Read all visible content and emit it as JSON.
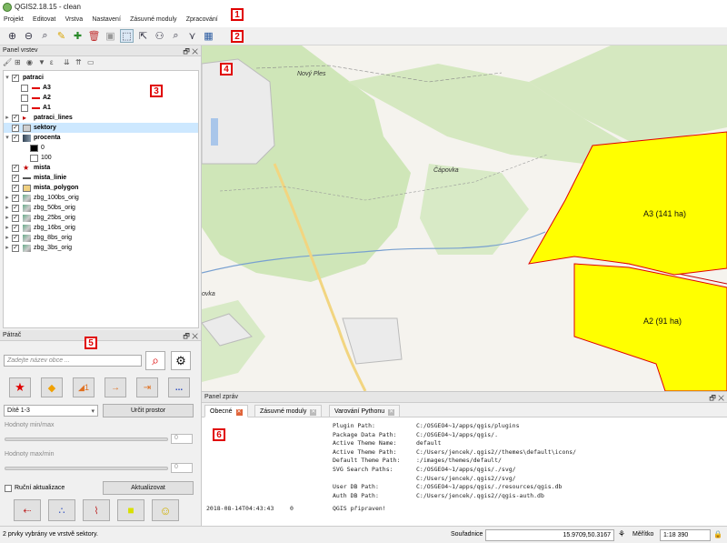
{
  "window": {
    "title": "QGIS2.18.15 - clean"
  },
  "menu": [
    "Projekt",
    "Editovat",
    "Vrstva",
    "Nastavení",
    "Zásuvné moduly",
    "Zpracování"
  ],
  "toolbar": {
    "icons": [
      "zoom-in-icon",
      "zoom-out-icon",
      "zoom-full-icon",
      "pencil-icon",
      "add-vector-icon",
      "delete-icon",
      "save-icon",
      "select-icon",
      "deselect-icon",
      "merge-icon",
      "search-icon",
      "node-tool-icon",
      "grid-icon"
    ]
  },
  "annotations": [
    "1",
    "2",
    "3",
    "4",
    "5",
    "6"
  ],
  "layers_panel": {
    "title": "Panel vrstev",
    "items": [
      {
        "label": "patraci",
        "bold": true,
        "checked": true,
        "expand": "▾",
        "indent": 0
      },
      {
        "label": "A3",
        "bold": true,
        "checked": false,
        "indent": 1,
        "color": "#e00000",
        "sym": "line"
      },
      {
        "label": "A2",
        "bold": true,
        "checked": false,
        "indent": 1,
        "color": "#e00000",
        "sym": "line"
      },
      {
        "label": "A1",
        "bold": true,
        "checked": false,
        "indent": 1,
        "color": "#e00000",
        "sym": "line"
      },
      {
        "label": "patraci_lines",
        "bold": true,
        "checked": true,
        "expand": "▸",
        "indent": 0,
        "color": "#c00000",
        "sym": "tri"
      },
      {
        "label": "sektory",
        "bold": true,
        "checked": true,
        "indent": 0,
        "selected": true,
        "color": "#cfcfcf",
        "sym": "fill"
      },
      {
        "label": "procenta",
        "bold": true,
        "checked": true,
        "expand": "▾",
        "indent": 0,
        "color": "#567",
        "sym": "raster"
      },
      {
        "label": "0",
        "bold": false,
        "indent": 2,
        "color": "#000",
        "sym": "fill"
      },
      {
        "label": "100",
        "bold": false,
        "indent": 2,
        "color": "#fff",
        "sym": "fill"
      },
      {
        "label": "mista",
        "bold": true,
        "checked": true,
        "indent": 0,
        "color": "#c00000",
        "sym": "star"
      },
      {
        "label": "mista_linie",
        "bold": true,
        "checked": true,
        "indent": 0,
        "color": "#555",
        "sym": "line"
      },
      {
        "label": "mista_polygon",
        "bold": true,
        "checked": true,
        "indent": 0,
        "color": "#f0d080",
        "sym": "fill"
      },
      {
        "label": "zbg_100bs_orig",
        "bold": false,
        "checked": true,
        "expand": "▸",
        "indent": 0,
        "sym": "raster2"
      },
      {
        "label": "zbg_50bs_orig",
        "bold": false,
        "checked": true,
        "expand": "▸",
        "indent": 0,
        "sym": "raster2"
      },
      {
        "label": "zbg_25bs_orig",
        "bold": false,
        "checked": true,
        "expand": "▸",
        "indent": 0,
        "sym": "raster2"
      },
      {
        "label": "zbg_16bs_orig",
        "bold": false,
        "checked": true,
        "expand": "▸",
        "indent": 0,
        "sym": "raster2"
      },
      {
        "label": "zbg_8bs_orig",
        "bold": false,
        "checked": true,
        "expand": "▸",
        "indent": 0,
        "sym": "raster2"
      },
      {
        "label": "zbg_3bs_orig",
        "bold": false,
        "checked": true,
        "expand": "▸",
        "indent": 0,
        "sym": "raster2"
      }
    ]
  },
  "patrac_panel": {
    "title": "Pátrač",
    "search_placeholder": "Zadejte název obce ...",
    "select_value": "Dítě 1-3",
    "determine_button": "Určit prostor",
    "min_max_label": "Hodnoty min/max",
    "max_max_label": "Hodnoty max/min",
    "spin_value": "0",
    "manual_update_label": "Ruční aktualizace",
    "update_button": "Aktualizovat",
    "more_label": "..."
  },
  "map": {
    "labels": {
      "town": "Nový Ples",
      "village": "Čápovka",
      "edge_town": "ovka"
    },
    "polygons": [
      {
        "label": "A3 (141 ha)",
        "color": "#ffff00"
      },
      {
        "label": "A2 (91 ha)",
        "color": "#ffff00"
      }
    ]
  },
  "messages_panel": {
    "title": "Panel zpráv",
    "tabs": [
      {
        "label": "Obecné",
        "active": true
      },
      {
        "label": "Zásuvné moduly",
        "active": false
      },
      {
        "label": "Varování Pythonu",
        "active": false
      }
    ],
    "log": [
      {
        "key": "Plugin Path:",
        "value": "C:/OSGEO4~1/apps/qgis/plugins"
      },
      {
        "key": "Package Data Path:",
        "value": "C:/OSGEO4~1/apps/qgis/."
      },
      {
        "key": "Active Theme Name:",
        "value": "default"
      },
      {
        "key": "Active Theme Path:",
        "value": "C:/Users/jencek/.qgis2//themes\\default\\icons/"
      },
      {
        "key": "Default Theme Path:",
        "value": ":/images/themes/default/"
      },
      {
        "key": "SVG Search Paths:",
        "value": "C:/OSGEO4~1/apps/qgis/./svg/"
      },
      {
        "key": "",
        "value": "C:/Users/jencek/.qgis2//svg/"
      },
      {
        "key": "User DB Path:",
        "value": "C:/OSGEO4~1/apps/qgis/./resources/qgis.db"
      },
      {
        "key": "Auth DB Path:",
        "value": "C:/Users/jencek/.qgis2//qgis-auth.db"
      }
    ],
    "final": {
      "time": "2018-08-14T04:43:43",
      "level": "0",
      "text": "QGIS připraven!"
    }
  },
  "status": {
    "message": "2 prvky vybrány ve vrstvě sektory.",
    "coord_label": "Souřadnice",
    "coord_value": "15.9709,50.3167",
    "scale_label": "Měřítko",
    "scale_value": "1:18 390"
  }
}
